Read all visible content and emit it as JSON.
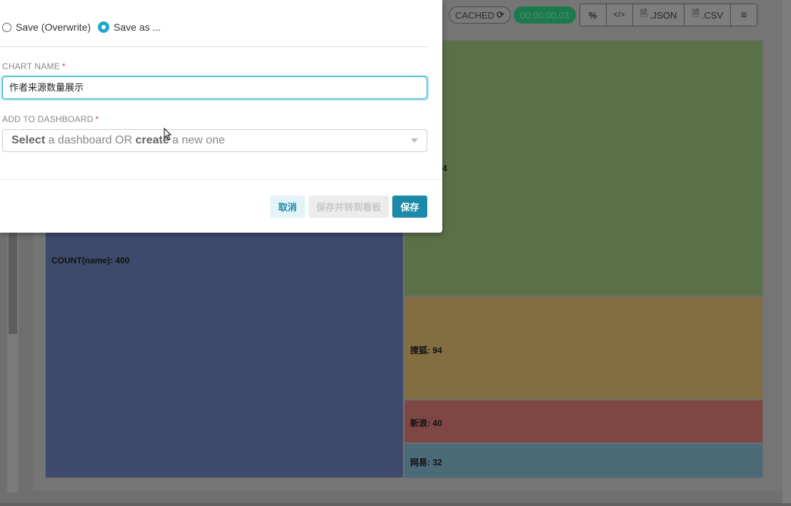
{
  "toolbar": {
    "cached_label": "CACHED",
    "timer": "00:00:00.03",
    "json_label": ".JSON",
    "csv_label": ".CSV"
  },
  "treemap": {
    "tiles": [
      {
        "label": "COUNT(name): 400",
        "value": 400,
        "color": "#3d4a6b"
      },
      {
        "label": "4",
        "value": 234,
        "color": "#5a7048"
      },
      {
        "label": "搜狐: 94",
        "value": 94,
        "color": "#826e41"
      },
      {
        "label": "新浪: 40",
        "value": 40,
        "color": "#7e4744"
      },
      {
        "label": "网易: 32",
        "value": 32,
        "color": "#4c6b79"
      }
    ]
  },
  "modal": {
    "save_overwrite_label": "Save (Overwrite)",
    "save_as_label": "Save as ...",
    "chart_name_label": "CHART NAME",
    "chart_name_value": "作者来源数量展示",
    "add_to_dashboard_label": "ADD TO DASHBOARD",
    "dashboard_placeholder_1": "Select",
    "dashboard_placeholder_2": " a dashboard OR ",
    "dashboard_placeholder_3": "create",
    "dashboard_placeholder_4": " a new one",
    "required_mark": "*",
    "cancel_label": "取消",
    "save_goto_label": "保存并转到看板",
    "save_label": "保存"
  }
}
